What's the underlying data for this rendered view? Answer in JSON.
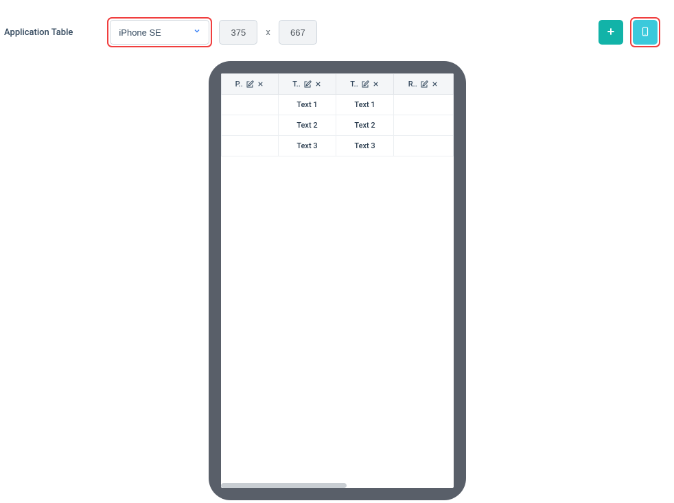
{
  "header": {
    "title": "Application Table",
    "device_selected": "iPhone SE",
    "width": "375",
    "height": "667",
    "dim_separator": "x"
  },
  "table": {
    "columns": [
      {
        "label": "P.."
      },
      {
        "label": "T.."
      },
      {
        "label": "T.."
      },
      {
        "label": "R.."
      }
    ],
    "rows": [
      {
        "c0": "",
        "c1": "Text 1",
        "c2": "Text 1",
        "c3": ""
      },
      {
        "c0": "",
        "c1": "Text 2",
        "c2": "Text 2",
        "c3": ""
      },
      {
        "c0": "",
        "c1": "Text 3",
        "c2": "Text 3",
        "c3": ""
      }
    ]
  }
}
